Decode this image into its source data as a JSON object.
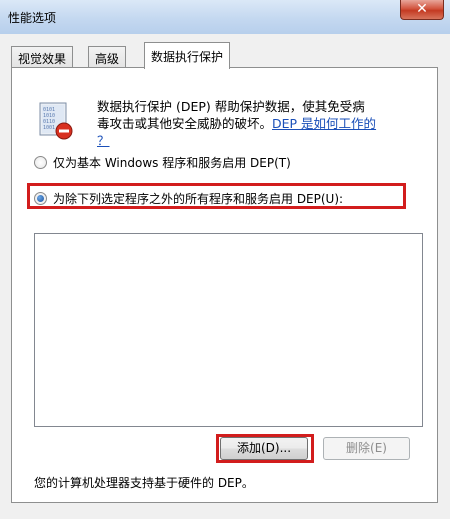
{
  "window": {
    "title": "性能选项",
    "close_label": "✕"
  },
  "tabs": [
    {
      "label": "视觉效果"
    },
    {
      "label": "高级"
    },
    {
      "label": "数据执行保护"
    }
  ],
  "dep": {
    "description_line1": "数据执行保护 (DEP) 帮助保护数据，使其免受病",
    "description_line2": "毒攻击或其他安全威胁的破坏。",
    "link_part1": "DEP 是如何工作的",
    "link_part2": "？"
  },
  "options": {
    "essential_only": "仅为基本 Windows 程序和服务启用 DEP(T)",
    "all_except": "为除下列选定程序之外的所有程序和服务启用 DEP(U):"
  },
  "buttons": {
    "add": "添加(D)...",
    "remove": "删除(E)"
  },
  "footer": {
    "hardware_support": "您的计算机处理器支持基于硬件的 DEP。"
  },
  "colors": {
    "highlight": "#d21d1d",
    "link": "#1a4fb8"
  }
}
